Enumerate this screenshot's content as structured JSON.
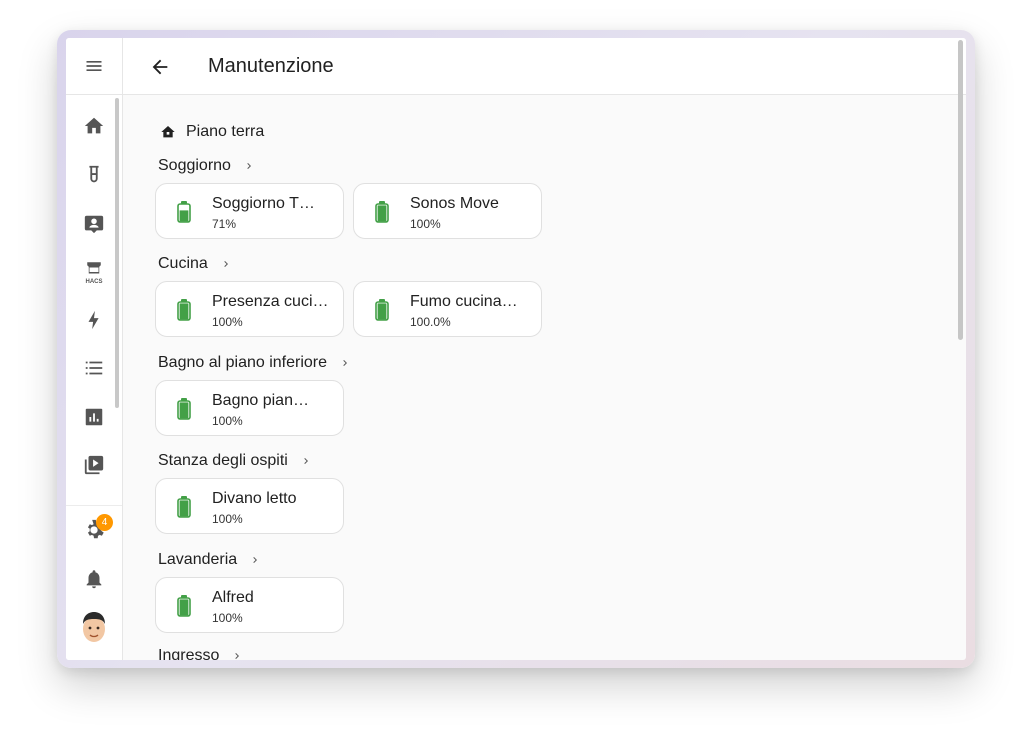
{
  "header": {
    "title": "Manutenzione"
  },
  "sidebar": {
    "items": [
      "home-icon",
      "flask-icon",
      "account-box-icon",
      "hacs-icon",
      "energy-icon",
      "list-icon",
      "chart-icon",
      "media-icon"
    ],
    "hacs_label": "HACS",
    "settings_badge": "4"
  },
  "floor": {
    "name": "Piano terra"
  },
  "areas": [
    {
      "name": "Soggiorno",
      "devices": [
        {
          "name": "Soggiorno T…",
          "state": "71%",
          "level": 0.71
        },
        {
          "name": "Sonos Move",
          "state": "100%",
          "level": 1.0
        }
      ]
    },
    {
      "name": "Cucina",
      "devices": [
        {
          "name": "Presenza cuci…",
          "state": "100%",
          "level": 1.0
        },
        {
          "name": "Fumo cucina…",
          "state": "100.0%",
          "level": 1.0
        }
      ]
    },
    {
      "name": "Bagno al piano inferiore",
      "devices": [
        {
          "name": "Bagno pian…",
          "state": "100%",
          "level": 1.0
        }
      ]
    },
    {
      "name": "Stanza degli ospiti",
      "devices": [
        {
          "name": "Divano letto",
          "state": "100%",
          "level": 1.0
        }
      ]
    },
    {
      "name": "Lavanderia",
      "devices": [
        {
          "name": "Alfred",
          "state": "100%",
          "level": 1.0
        }
      ]
    },
    {
      "name": "Ingresso",
      "devices": []
    }
  ],
  "colors": {
    "battery": "#43a047",
    "badge": "#ff9800",
    "icon": "#555555"
  }
}
